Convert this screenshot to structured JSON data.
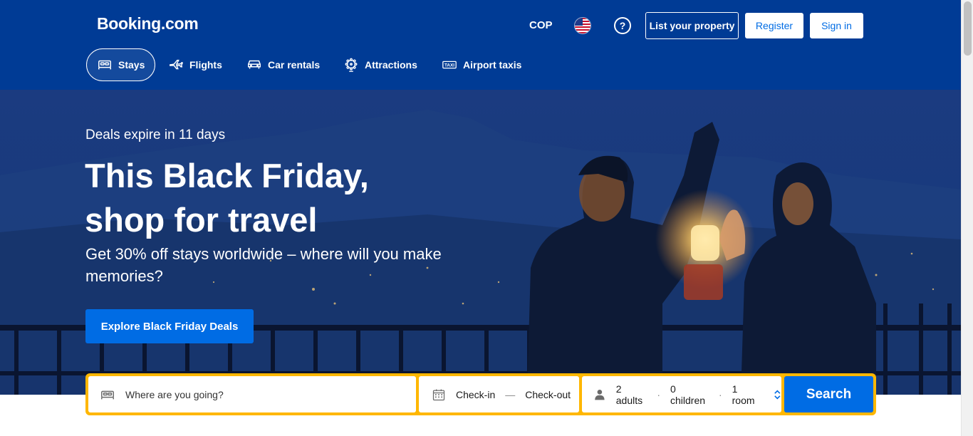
{
  "header": {
    "logo": "Booking.com",
    "currency": "COP",
    "help": "?",
    "list_property": "List your property",
    "register": "Register",
    "sign_in": "Sign in"
  },
  "nav": {
    "items": [
      {
        "label": "Stays",
        "icon": "bed-icon",
        "active": true
      },
      {
        "label": "Flights",
        "icon": "plane-icon",
        "active": false
      },
      {
        "label": "Car rentals",
        "icon": "car-icon",
        "active": false
      },
      {
        "label": "Attractions",
        "icon": "ferris-wheel-icon",
        "active": false
      },
      {
        "label": "Airport taxis",
        "icon": "taxi-icon",
        "active": false
      }
    ]
  },
  "hero": {
    "deals_label": "Deals expire in 11 days",
    "headline_line1": "This Black Friday,",
    "headline_line2": "shop for travel",
    "subheadline": "Get 30% off stays worldwide – where will you make memories?",
    "cta": "Explore Black Friday Deals"
  },
  "search": {
    "destination_placeholder": "Where are you going?",
    "check_in": "Check-in",
    "dash": "—",
    "check_out": "Check-out",
    "adults": "2 adults",
    "children": "0 children",
    "rooms": "1 room",
    "dot": "·",
    "button": "Search"
  },
  "colors": {
    "brand_blue": "#003b95",
    "action_blue": "#006ce4",
    "search_border": "#ffb700"
  }
}
